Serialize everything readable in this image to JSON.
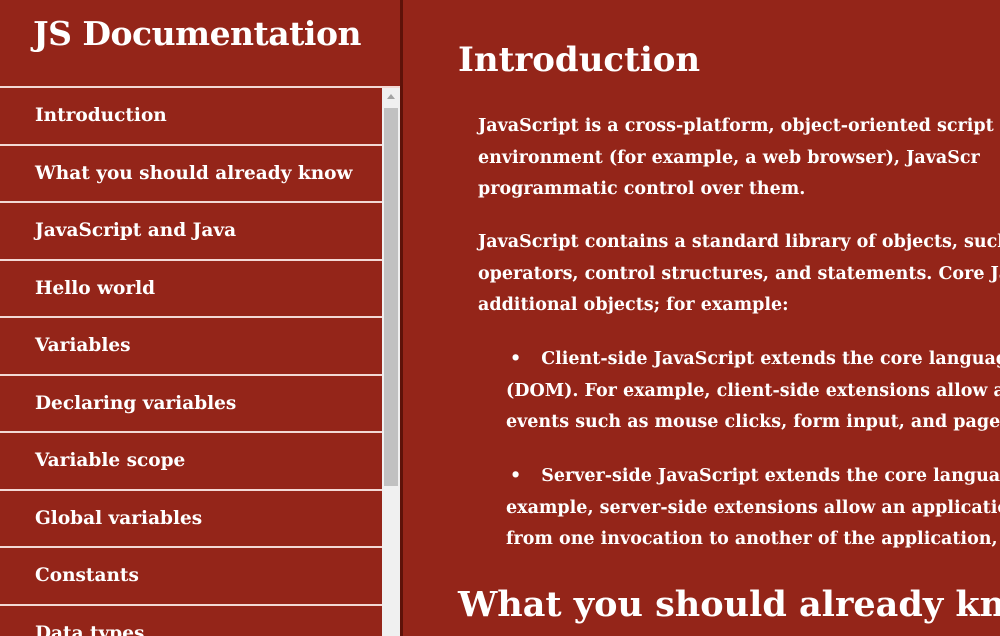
{
  "sidebar": {
    "title": "JS Documentation",
    "items": [
      {
        "label": "Introduction"
      },
      {
        "label": "What you should already know"
      },
      {
        "label": "JavaScript and Java"
      },
      {
        "label": "Hello world"
      },
      {
        "label": "Variables"
      },
      {
        "label": "Declaring variables"
      },
      {
        "label": "Variable scope"
      },
      {
        "label": "Global variables"
      },
      {
        "label": "Constants"
      },
      {
        "label": "Data types"
      }
    ]
  },
  "main": {
    "intro_title": "Introduction",
    "para1": [
      "JavaScript is a cross-platform, object-oriented script",
      "environment (for example, a web browser), JavaScr",
      "programmatic control over them."
    ],
    "para2": [
      "JavaScript contains a standard library of objects, such",
      "operators, control structures, and statements. Core Java",
      "additional objects; for example:"
    ],
    "bullet1": [
      "Client-side JavaScript extends the core language b",
      "(DOM). For example, client-side extensions allow an a",
      "events such as mouse clicks, form input, and page na"
    ],
    "bullet2": [
      "Server-side JavaScript extends the core language",
      "example, server-side extensions allow an application",
      "from one invocation to another of the application, or"
    ],
    "next_title": "What you should already know"
  },
  "colors": {
    "background": "#942519",
    "divider": "#f3d9d5",
    "text": "#ffffff"
  }
}
